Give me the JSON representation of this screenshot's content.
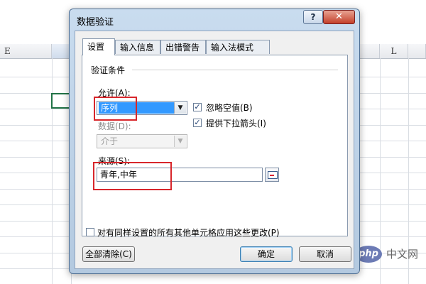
{
  "spreadsheet": {
    "column_headers": [
      "E",
      "L"
    ],
    "watermark": {
      "logo": "php",
      "text": "中文网"
    }
  },
  "dialog": {
    "title": "数据验证",
    "help_button": "?",
    "close_button": "✕",
    "tabs": [
      {
        "label": "设置",
        "active": true
      },
      {
        "label": "输入信息",
        "active": false
      },
      {
        "label": "出错警告",
        "active": false
      },
      {
        "label": "输入法模式",
        "active": false
      }
    ],
    "criteria": {
      "group_title": "验证条件",
      "allow_label": "允许(A):",
      "allow_value": "序列",
      "ignore_blank_label": "忽略空值(B)",
      "ignore_blank_checked": true,
      "dropdown_label": "提供下拉箭头(I)",
      "dropdown_checked": true,
      "data_label": "数据(D):",
      "data_value": "介于",
      "source_label": "来源(S):",
      "source_value": "青年,中年"
    },
    "apply_all_label": "对有同样设置的所有其他单元格应用这些更改(P)",
    "apply_all_checked": false,
    "buttons": {
      "clear_all": "全部清除(C)",
      "ok": "确定",
      "cancel": "取消"
    },
    "checkmark": "✓",
    "arrow_glyph": "▼"
  },
  "colors": {
    "highlight": "#d8262b",
    "selection": "#3399ff"
  }
}
